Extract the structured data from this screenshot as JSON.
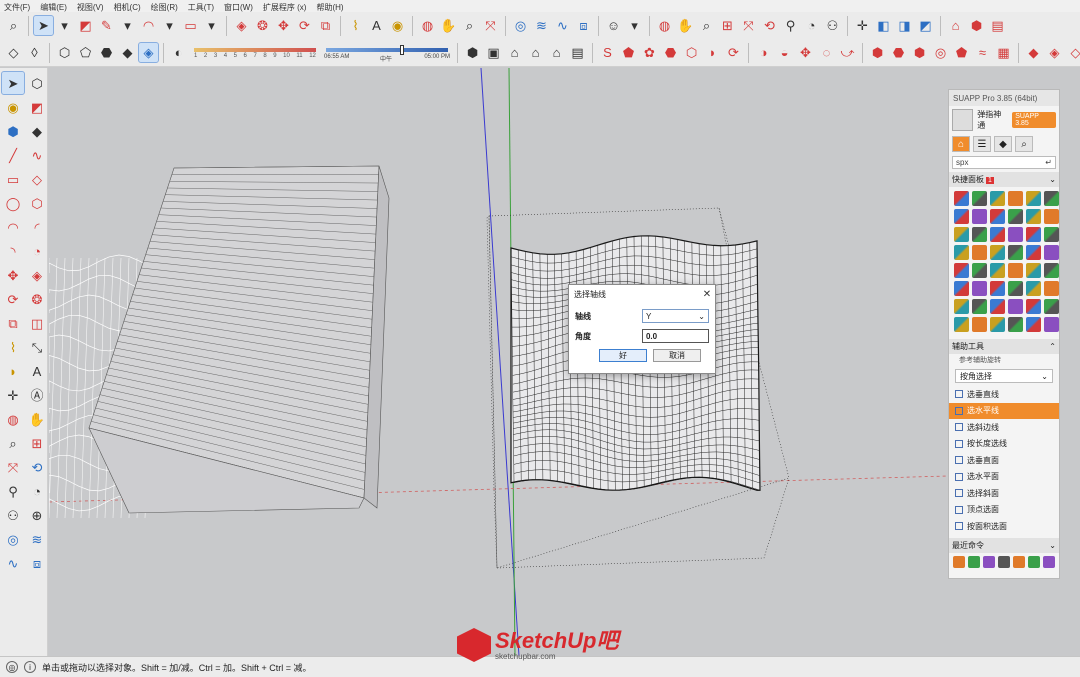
{
  "menu": [
    "文件(F)",
    "编辑(E)",
    "视图(V)",
    "相机(C)",
    "绘图(R)",
    "工具(T)",
    "窗口(W)",
    "扩展程序 (x)",
    "帮助(H)"
  ],
  "toolbar": {
    "shadow_ticks": [
      "1",
      "2",
      "3",
      "4",
      "5",
      "6",
      "7",
      "8",
      "9",
      "10",
      "11",
      "12"
    ],
    "time_start": "06:55 AM",
    "time_mid": "中午",
    "time_end": "05:00 PM"
  },
  "dialog": {
    "title": "选择轴线",
    "axis_label": "轴线",
    "axis_value": "Y",
    "angle_label": "角度",
    "angle_value": "0.0",
    "ok_label": "好",
    "cancel_label": "取消"
  },
  "suapp": {
    "title": "SUAPP Pro 3.85 (64bit)",
    "user_name": "弹指神通",
    "version_badge": "SUAPP 3.85",
    "search_value": "spx",
    "quick_panel_label": "快捷面板",
    "quick_panel_count": "1",
    "aux_tools_label": "辅助工具",
    "aux_sub_hint": "参考辅助旋转",
    "select_mode": "按角选择",
    "items": [
      "选垂直线",
      "选水平线",
      "选斜边线",
      "按长度选线",
      "选垂直面",
      "选水平面",
      "选择斜面",
      "顶点选面",
      "按面积选面"
    ],
    "active_item_index": 1,
    "recent_label": "最近命令"
  },
  "status": {
    "text": "单击或拖动以选择对象。Shift = 加/减。Ctrl = 加。Shift + Ctrl = 减。"
  },
  "watermark": {
    "name": "SketchUp吧",
    "url": "sketchupbar.com"
  },
  "colors": {
    "accent": "#f08c2c",
    "brand_red": "#d8282d",
    "viewport_bg": "#c8c9cb"
  }
}
